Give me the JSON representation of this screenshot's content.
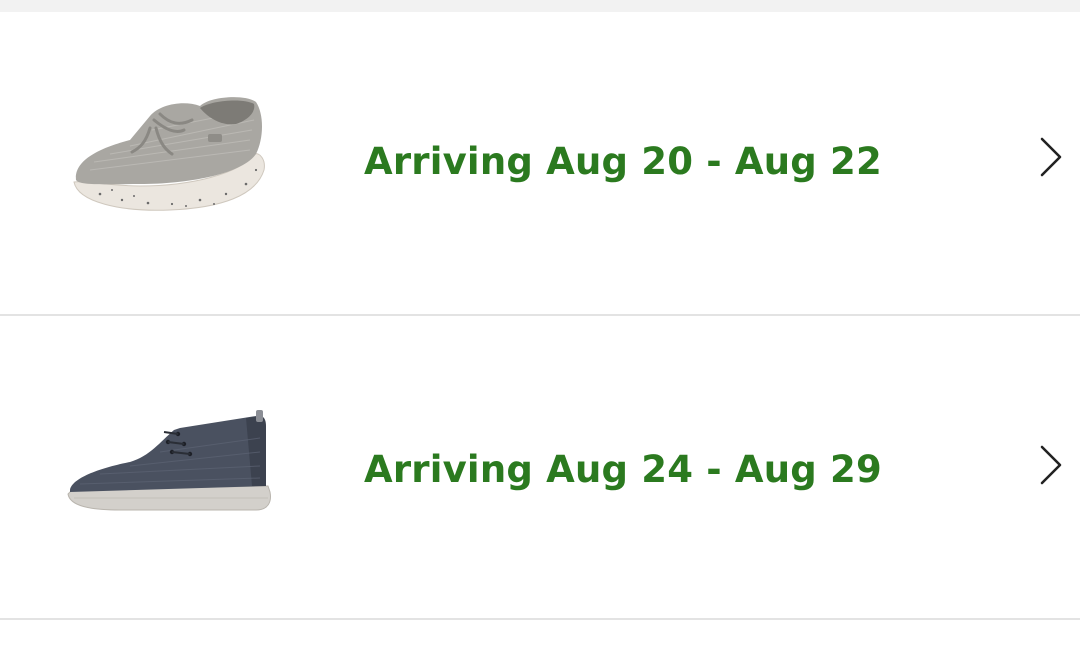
{
  "orders": [
    {
      "status": "Arriving Aug 20 - Aug 22",
      "image_icon": "gray-slip-on-shoe-image",
      "chevron_icon": "chevron-right-icon"
    },
    {
      "status": "Arriving Aug 24 - Aug 29",
      "image_icon": "navy-chukka-boot-image",
      "chevron_icon": "chevron-right-icon"
    }
  ],
  "colors": {
    "status_green": "#2b7a1f",
    "divider": "#e3e3e3",
    "top_band": "#f2f2f2"
  }
}
